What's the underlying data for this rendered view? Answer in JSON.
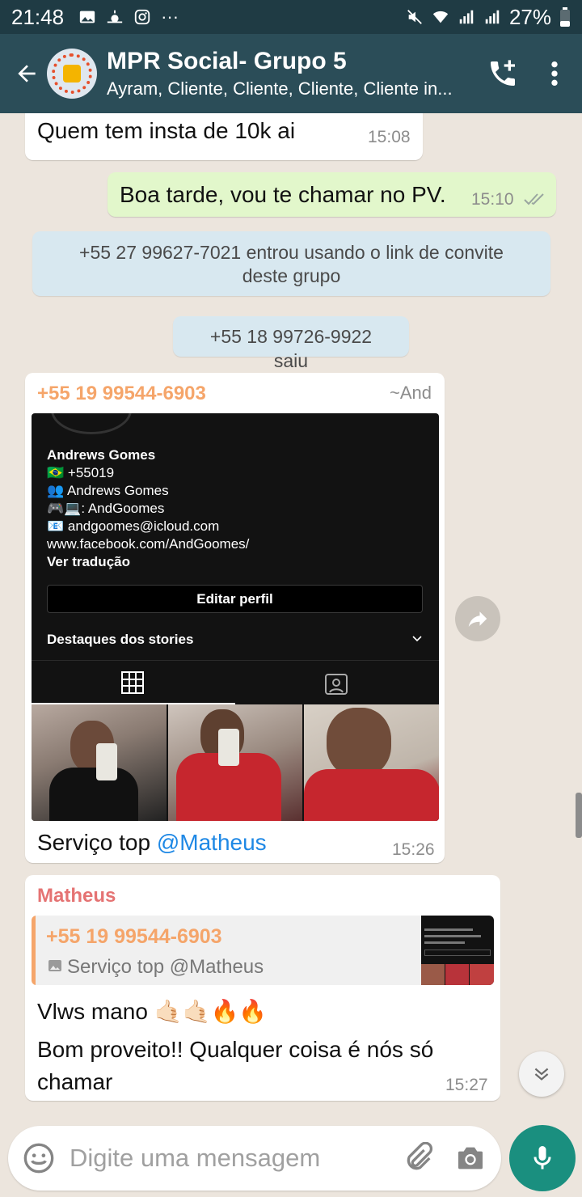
{
  "status_bar": {
    "time": "21:48",
    "dots": "···",
    "battery": "27%"
  },
  "header": {
    "title": "MPR Social- Grupo 5",
    "subtitle": "Ayram, Cliente, Cliente, Cliente, Cliente in..."
  },
  "messages": {
    "m1": {
      "text": "Quem tem insta de 10k ai",
      "time": "15:08"
    },
    "m2": {
      "text": "Boa tarde, vou te chamar no PV.",
      "time": "15:10"
    },
    "sys1": "+55 27 99627-7021 entrou usando o link de convite deste grupo",
    "sys2": "+55 18 99726-9922 saiu",
    "m3": {
      "sender": "+55 19 99544-6903",
      "sender_alias": "~And",
      "caption_prefix": "Serviço top ",
      "mention": "@Matheus",
      "time": "15:26",
      "image": {
        "name": "Andrews Gomes",
        "line1": "🇧🇷 +55019",
        "line2": "👥 Andrews Gomes",
        "line3": "🎮💻: AndGoomes",
        "line4": "📧 andgoomes@icloud.com",
        "line5": "www.facebook.com/AndGoomes/",
        "translate": "Ver tradução",
        "edit_profile": "Editar perfil",
        "highlights": "Destaques dos stories"
      }
    },
    "m4": {
      "sender": "Matheus",
      "quote_sender": "+55 19 99544-6903",
      "quote_text": "Serviço top @Matheus",
      "line1": "Vlws mano 🤙🏻🤙🏻🔥🔥",
      "line2": "Bom proveito!! Qualquer coisa é nós só chamar",
      "time": "15:27"
    }
  },
  "input": {
    "placeholder": "Digite uma mensagem"
  },
  "colors": {
    "header": "#2b4d58",
    "accent": "#1a8f7f",
    "out_bubble": "#e2f7cb",
    "sender_orange": "#f5a56a",
    "sender_red": "#e57373",
    "mention": "#1e88e5"
  }
}
